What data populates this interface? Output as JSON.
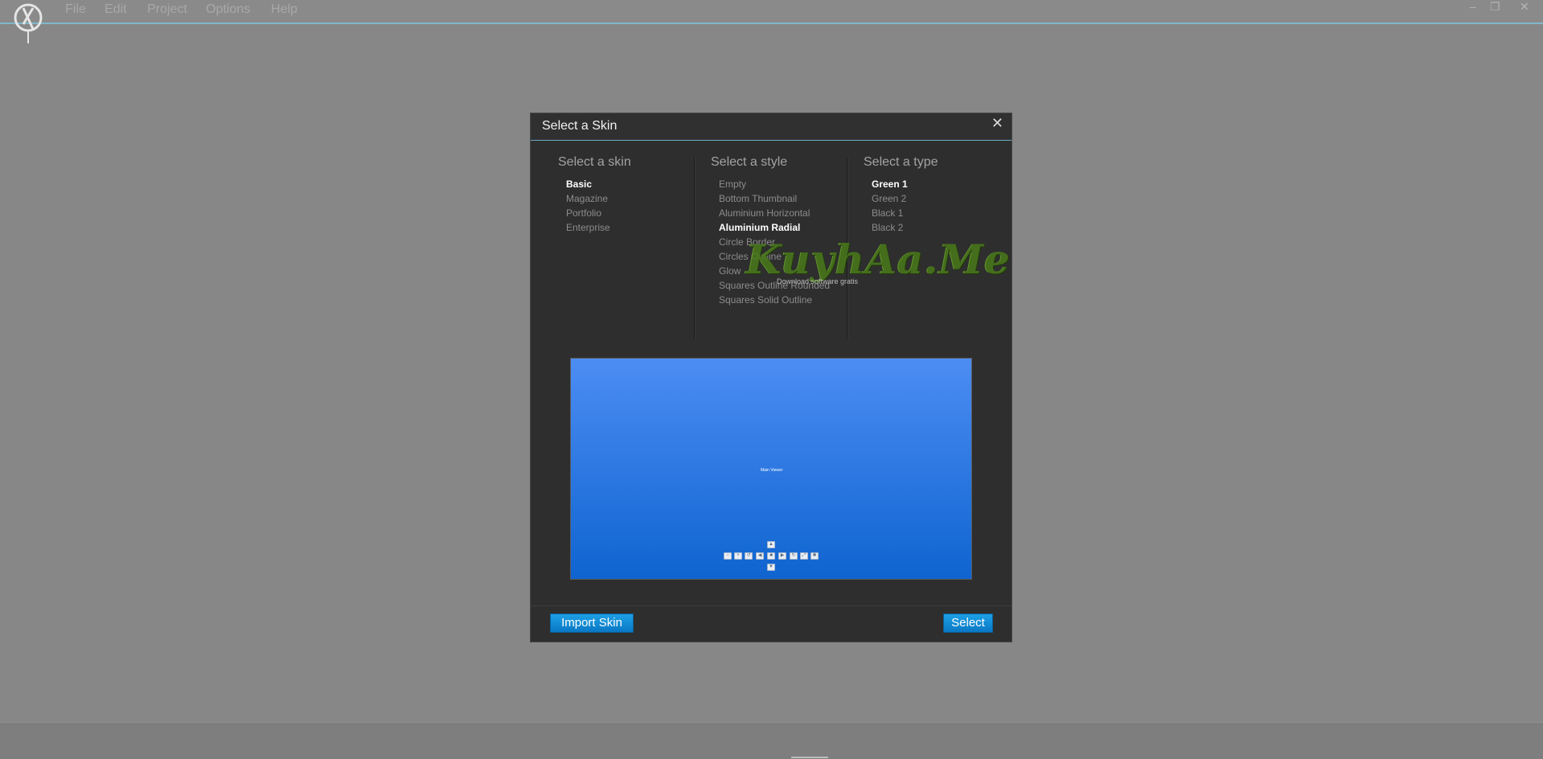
{
  "menubar": {
    "items": [
      "File",
      "Edit",
      "Project",
      "Options",
      "Help"
    ],
    "window_controls": [
      "–",
      "❐",
      "✕"
    ]
  },
  "dialog": {
    "title": "Select a Skin",
    "close": "✕",
    "skin": {
      "heading": "Select a skin",
      "items": [
        "Basic",
        "Magazine",
        "Portfolio",
        "Enterprise"
      ],
      "selected": "Basic"
    },
    "style": {
      "heading": "Select a style",
      "items": [
        "Empty",
        "Bottom Thumbnail",
        "Aluminium Horizontal",
        "Aluminium Radial",
        "Circle Border",
        "Circles Outline",
        "Glow",
        "Squares Outline Rounded",
        "Squares Solid Outline"
      ],
      "selected": "Aluminium Radial"
    },
    "type": {
      "heading": "Select a type",
      "items": [
        "Green 1",
        "Green 2",
        "Black 1",
        "Black 2"
      ],
      "selected": "Green 1"
    },
    "preview": {
      "caption": "Main Viewer"
    },
    "import_button": "Import Skin",
    "select_button": "Select"
  },
  "watermark": {
    "text": "KuyhAa.Me",
    "sub": "Download software gratis"
  },
  "colors": {
    "accent": "#0a86d4",
    "selected_text": "#ffffff",
    "dim_text": "#8c8c8c",
    "dialog_bg": "#2e2e2e",
    "overlay_bg": "#878787"
  }
}
